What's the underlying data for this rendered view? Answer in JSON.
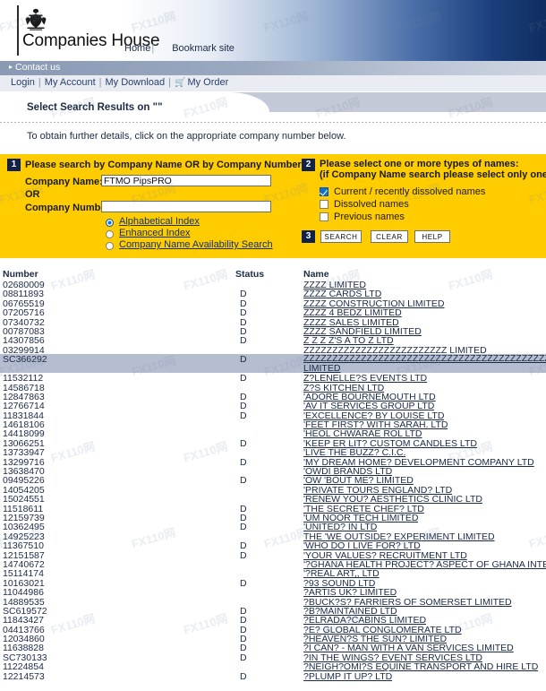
{
  "header": {
    "brand": "Companies House",
    "crest_icon": "royal-crest-icon",
    "nav": [
      {
        "label": "Home",
        "name": "nav-home"
      },
      {
        "label": "Bookmark site",
        "name": "nav-bookmark-site"
      }
    ],
    "contact": {
      "label": "Contact us",
      "arrow_icon": "chevron-right-icon"
    },
    "account_links": [
      {
        "label": "Login",
        "name": "link-login"
      },
      {
        "label": "My Account",
        "name": "link-my-account"
      },
      {
        "label": "My Download",
        "name": "link-my-download"
      },
      {
        "label": "My Order",
        "name": "link-my-order",
        "icon": "shopping-cart-icon"
      }
    ]
  },
  "page": {
    "title": "Select Search Results on \"\"",
    "subtitle": "To obtain further details, click on the appropriate company number below."
  },
  "search": {
    "step1": {
      "number": "1",
      "heading": "Please search by Company Name OR by Company Number:",
      "company_name_label": "Company Name:",
      "company_name_value": "FTMO PipsPRO",
      "company_name_placeholder": "",
      "or_label": "OR",
      "company_number_label": "Company Number:",
      "company_number_value": "",
      "company_number_placeholder": "",
      "index_options": [
        {
          "label": "Alphabetical Index",
          "selected": true,
          "name": "radio-alphabetical-index"
        },
        {
          "label": "Enhanced Index",
          "selected": false,
          "name": "radio-enhanced-index"
        },
        {
          "label": "Company Name Availability Search",
          "selected": false,
          "name": "radio-name-availability-search"
        }
      ]
    },
    "step2": {
      "number": "2",
      "heading_line1": "Please select one or more types of names:",
      "heading_line2": "(if Company Name search please select only one)",
      "name_types": [
        {
          "label": "Current / recently dissolved names",
          "checked": true,
          "name": "checkbox-current-names"
        },
        {
          "label": "Dissolved names",
          "checked": false,
          "name": "checkbox-dissolved-names"
        },
        {
          "label": "Previous names",
          "checked": false,
          "name": "checkbox-previous-names"
        }
      ]
    },
    "step3": {
      "number": "3",
      "buttons": [
        {
          "label": "SEARCH",
          "name": "search-button"
        },
        {
          "label": "CLEAR",
          "name": "clear-button"
        },
        {
          "label": "HELP",
          "name": "help-button"
        }
      ]
    }
  },
  "results": {
    "columns": [
      "Number",
      "Status",
      "Name"
    ],
    "rows": [
      {
        "number": "02680009",
        "status": "",
        "name": "ZZZZ LIMITED"
      },
      {
        "number": "08811893",
        "status": "D",
        "name": "ZZZZ CARDS LTD"
      },
      {
        "number": "06765519",
        "status": "D",
        "name": "ZZZZ CONSTRUCTION LIMITED"
      },
      {
        "number": "07205716",
        "status": "D",
        "name": "ZZZZ 4 BEDZ LIMITED"
      },
      {
        "number": "07340732",
        "status": "D",
        "name": "ZZZZ SALES LIMITED"
      },
      {
        "number": "00787083",
        "status": "D",
        "name": "ZZZZ SANDFIELD LIMITED"
      },
      {
        "number": "14307856",
        "status": "D",
        "name": "Z Z Z Z'S A TO Z LTD"
      },
      {
        "number": "03299914",
        "status": "",
        "name": "ZZZZZZZZZZZZZZZZZZZZZZZZZ LIMITED"
      },
      {
        "number": "SC366292",
        "status": "D",
        "name": "ZZZZZZZZZZZZZZZZZZZZZZZZZZZZZZZZZZZZZZZZZZZZZZZZZZZZZZZZZZ LIMITED",
        "highlight": true,
        "tall": true
      },
      {
        "number": "11532112",
        "status": "D",
        "name": "Z?LENELLE?S EVENTS LTD"
      },
      {
        "number": "14586718",
        "status": "",
        "name": "Z?S KITCHEN LTD"
      },
      {
        "number": "12847863",
        "status": "D",
        "name": "'ADORE BOURNEMOUTH LTD"
      },
      {
        "number": "12766714",
        "status": "D",
        "name": "'AV IT SERVICES GROUP LTD"
      },
      {
        "number": "11831844",
        "status": "D",
        "name": "'EXCELLENCE? BY LOUISE LTD"
      },
      {
        "number": "14618106",
        "status": "",
        "name": "'FEET FIRST? WITH SARAH. LTD"
      },
      {
        "number": "14418099",
        "status": "",
        "name": "'HEOL CHWARAE ROL LTD"
      },
      {
        "number": "13066251",
        "status": "D",
        "name": "'KEEP ER LIT? CUSTOM CANDLES LTD"
      },
      {
        "number": "13733947",
        "status": "",
        "name": "'LIVE THE BUZZ? C.I.C."
      },
      {
        "number": "13299716",
        "status": "D",
        "name": "'MY DREAM HOME? DEVELOPMENT COMPANY LTD"
      },
      {
        "number": "13638470",
        "status": "",
        "name": "'OWDI BRANDS LTD"
      },
      {
        "number": "09495226",
        "status": "D",
        "name": "'OW 'BOUT ME? LIMITED"
      },
      {
        "number": "14054205",
        "status": "",
        "name": "'PRIVATE TOURS ENGLAND? LTD"
      },
      {
        "number": "15024551",
        "status": "",
        "name": "'RENEW YOU? AESTHETICS CLINIC LTD"
      },
      {
        "number": "11518611",
        "status": "D",
        "name": "'THE SECRETE CHEF? LTD"
      },
      {
        "number": "12159739",
        "status": "D",
        "name": "'UM NOOR TECH LIMITED"
      },
      {
        "number": "10362495",
        "status": "D",
        "name": "'UNITED? IN LTD"
      },
      {
        "number": "14925223",
        "status": "",
        "name": "THE 'WE OUTSIDE? EXPERIMENT LIMITED"
      },
      {
        "number": "11367510",
        "status": "D",
        "name": "'WHO DO I LIVE FOR? LTD"
      },
      {
        "number": "12151587",
        "status": "D",
        "name": "'YOUR VALUES? RECRUITMENT LTD"
      },
      {
        "number": "14740672",
        "status": "",
        "name": "'?GHANA HEALTH PROJECT? ASPECT OF GHANA INTERNATIONAL"
      },
      {
        "number": "15114174",
        "status": "",
        "name": "'?REAL ART,, LTD"
      },
      {
        "number": "10163021",
        "status": "D",
        "name": "?93 SOUND LTD"
      },
      {
        "number": "11044986",
        "status": "",
        "name": "?ARTIS UK? LIMITED"
      },
      {
        "number": "14889535",
        "status": "",
        "name": "?BUCK?S? FARRIERS OF SOMERSET LIMITED"
      },
      {
        "number": "SC619572",
        "status": "D",
        "name": "?B?MAINTAINED LTD"
      },
      {
        "number": "11843427",
        "status": "D",
        "name": "?ELRADA?CABINS LIMITED"
      },
      {
        "number": "04413766",
        "status": "D",
        "name": "?E? GLOBAL CONGLOMERATE LTD"
      },
      {
        "number": "12034860",
        "status": "D",
        "name": "?HEAVEN?S THE SUN? LIMITED"
      },
      {
        "number": "11638828",
        "status": "D",
        "name": "?I CAN? - MAN WITH A VAN SERVICES LIMITED"
      },
      {
        "number": "SC730133",
        "status": "D",
        "name": "?IN THE WINGS? EVENT SERVICES LTD"
      },
      {
        "number": "11224854",
        "status": "",
        "name": "?NEIGH?OMI?S EQUINE TRANSPORT AND HIRE LTD"
      },
      {
        "number": "12214573",
        "status": "D",
        "name": "?PLUMP IT UP? LTD"
      }
    ]
  },
  "watermarks": [
    "FX110网",
    "FX110网",
    "FX110网",
    "FX110网",
    "FX110网",
    "FX110网",
    "FX110网",
    "FX110网",
    "FX110网",
    "FX110网",
    "FX110网",
    "FX110网",
    "FX110网",
    "FX110网",
    "FX110网",
    "FX110网",
    "FX110网",
    "FX110网",
    "FX110网",
    "FX110网",
    "FX110网",
    "FX110网",
    "FX110网",
    "FX110网",
    "FX110网",
    "FX110网",
    "FX110网",
    "FX110网"
  ],
  "colors": {
    "accent_yellow": "#ffcc00",
    "step_badge": "#11224a",
    "highlight_row": "#b5bdd0",
    "link": "#13306b"
  }
}
